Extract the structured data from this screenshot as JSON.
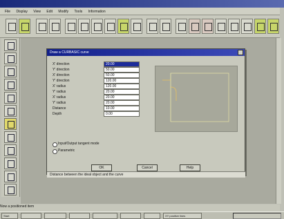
{
  "app": {
    "title": ""
  },
  "menu": {
    "items": [
      "File",
      "Display",
      "View",
      "Edit",
      "Modify",
      "Tools",
      "Information"
    ]
  },
  "dialog": {
    "title": "Draw a CURBASIC curve",
    "fields": [
      {
        "label": "X' direction",
        "value": "20.00",
        "selected": true
      },
      {
        "label": "Y' direction",
        "value": "50.00",
        "selected": false
      },
      {
        "label": "X' direction",
        "value": "50.00",
        "selected": false
      },
      {
        "label": "Y' direction",
        "value": "120.00",
        "selected": false
      },
      {
        "label": "X' radius",
        "value": "120.00",
        "selected": false
      },
      {
        "label": "Y' radius",
        "value": "20.00",
        "selected": false
      },
      {
        "label": "X' radius",
        "value": "20.00",
        "selected": false
      },
      {
        "label": "Y' radius",
        "value": "20.00",
        "selected": false
      },
      {
        "label": "Distance",
        "value": "10.00",
        "selected": false
      },
      {
        "label": "Depth",
        "value": "0.00",
        "selected": false
      }
    ],
    "options": [
      "Input/Output tangent mode",
      "Parametric"
    ],
    "buttons": {
      "ok": "OK",
      "cancel": "Cancel",
      "help": "Help"
    },
    "status": "Distance between the ideal object and the curve"
  },
  "bottom": {
    "hint": "Now a positioned item"
  },
  "taskbar": {
    "items": [
      "Start",
      "",
      "",
      "",
      "",
      "",
      "",
      "XY positive lines"
    ]
  }
}
